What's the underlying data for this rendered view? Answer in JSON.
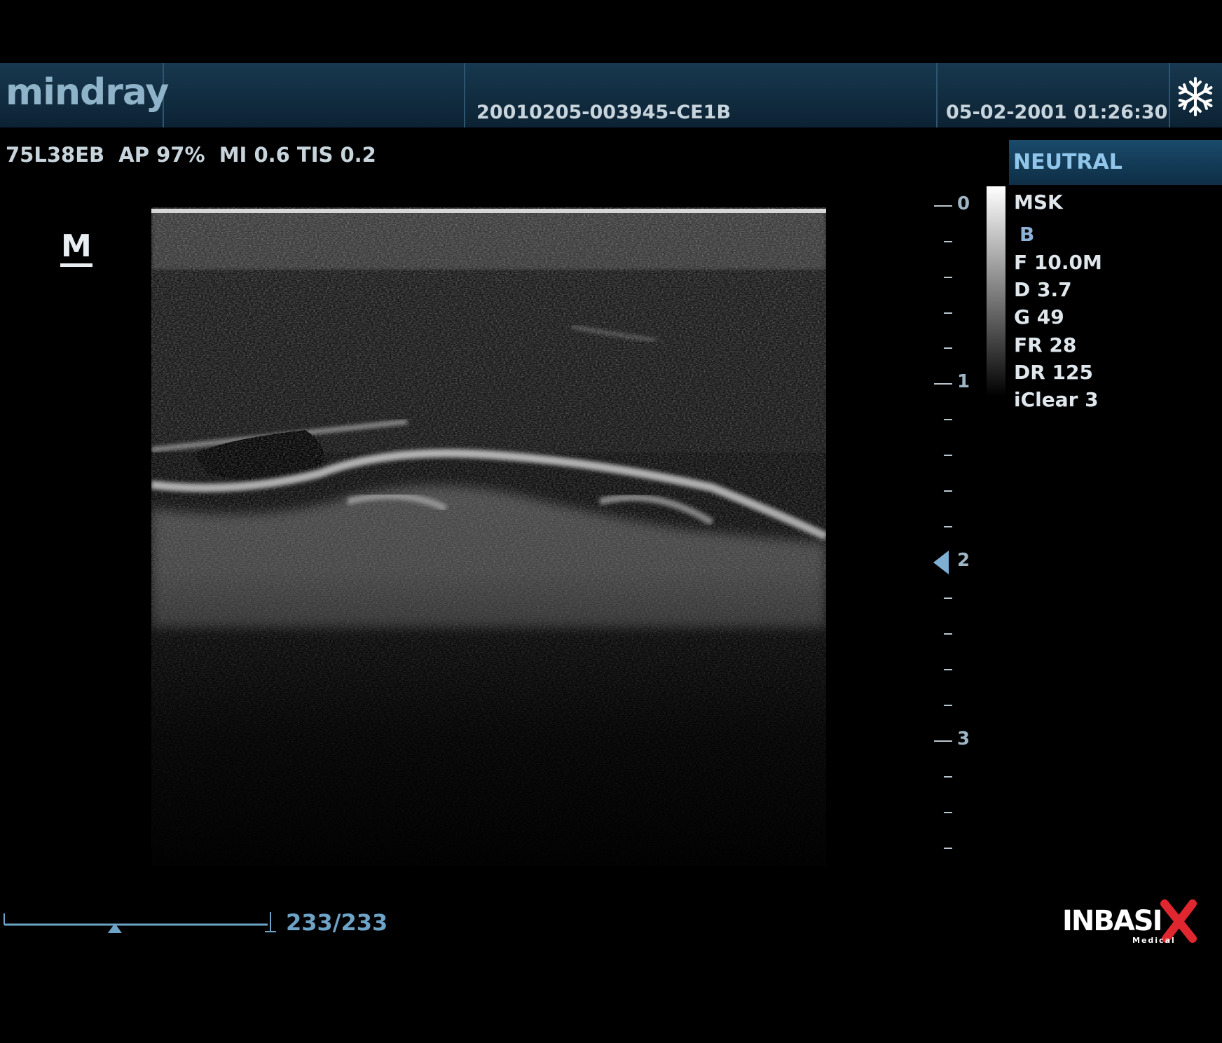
{
  "header": {
    "brand": "mindray",
    "patient_id": "20010205-003945-CE1B",
    "datetime": "05-02-2001 01:26:30",
    "freeze_icon": "snowflake-icon"
  },
  "probe_info": "75L38EB  AP 97%  MI 0.6 TIS 0.2",
  "orientation_marker": "M",
  "preset": "NEUTRAL",
  "params": {
    "exam": "MSK",
    "mode": "B",
    "frequency": "F 10.0M",
    "depth": "D 3.7",
    "gain": "G 49",
    "frame_rate": "FR 28",
    "dynamic_range": "DR 125",
    "iclear": "iClear 3"
  },
  "depth_scale": {
    "labels": [
      "0",
      "1",
      "2",
      "3"
    ],
    "focus_depth_label": "2"
  },
  "cine": {
    "frame_counter": "233/233",
    "position_fraction": 0.42
  },
  "watermark": {
    "text": "INBASIX",
    "subtext": "Medical",
    "colors": {
      "text": "#ffffff",
      "accent": "#e0262f"
    }
  },
  "colors": {
    "header": "#17384f",
    "accent_blue": "#6ea3c8",
    "text": "#c8d4dc"
  }
}
